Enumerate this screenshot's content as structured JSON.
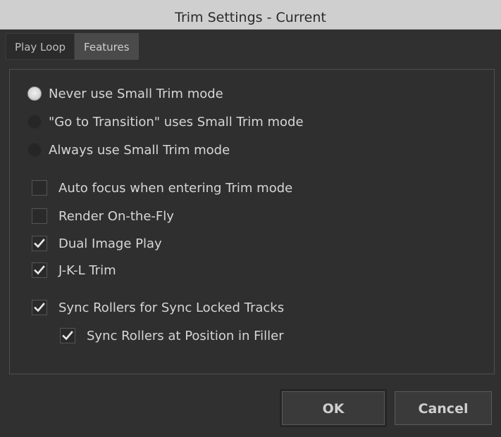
{
  "window": {
    "title": "Trim Settings - Current"
  },
  "tabs": [
    {
      "label": "Play Loop",
      "active": false
    },
    {
      "label": "Features",
      "active": true
    }
  ],
  "radio_options": [
    {
      "label": "Never use Small Trim mode",
      "selected": true
    },
    {
      "label": "\"Go to Transition\" uses Small Trim mode",
      "selected": false
    },
    {
      "label": "Always use Small Trim mode",
      "selected": false
    }
  ],
  "checkboxes": [
    {
      "label": "Auto focus when entering Trim mode",
      "checked": false
    },
    {
      "label": "Render On-the-Fly",
      "checked": false
    },
    {
      "label": "Dual Image Play",
      "checked": true
    },
    {
      "label": "J-K-L Trim",
      "checked": true
    },
    {
      "label": "Sync Rollers for Sync Locked Tracks",
      "checked": true
    },
    {
      "label": "Sync Rollers at Position in Filler",
      "checked": true
    }
  ],
  "buttons": {
    "ok": "OK",
    "cancel": "Cancel"
  },
  "colors": {
    "background": "#303030",
    "titlebar": "#cfcfcf",
    "active_tab": "#4a4a4a"
  }
}
